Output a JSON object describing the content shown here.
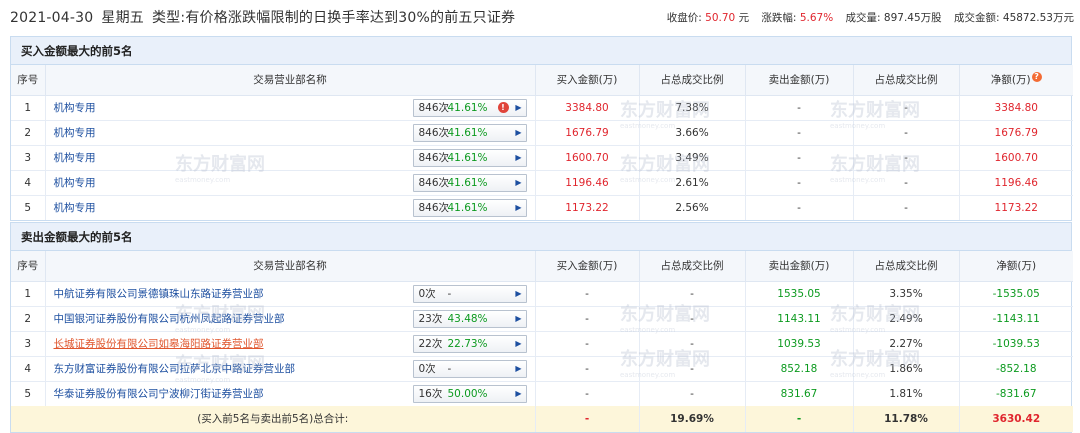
{
  "header": {
    "date": "2021-04-30",
    "weekday": "星期五",
    "type_label": "类型:",
    "type_value": "有价格涨跌幅限制的日换手率达到30%的前五只证券",
    "close_label": "收盘价:",
    "close_value": "50.70",
    "close_unit": "元",
    "change_label": "涨跌幅:",
    "change_value": "5.67%",
    "volume_label": "成交量:",
    "volume_value": "897.45万股",
    "amount_label": "成交金额:",
    "amount_value": "45872.53万元"
  },
  "watermark": {
    "text": "东方财富网",
    "subtext": "eastmoney.com"
  },
  "colors": {
    "red": "#e0262e",
    "green": "#0c9a1f",
    "link": "#1d4fa0",
    "header_bg": "#e9f0fa",
    "total_bg": "#fdf6da"
  },
  "buy": {
    "title": "买入金额最大的前5名",
    "columns": [
      "序号",
      "交易营业部名称",
      "买入金额(万)",
      "占总成交比例",
      "卖出金额(万)",
      "占总成交比例",
      "净额(万)"
    ],
    "rows": [
      {
        "idx": "1",
        "name": "机构专用",
        "count": "846次",
        "pct": "41.61%",
        "buy": "3384.80",
        "buy_ratio": "7.38%",
        "sell": "-",
        "sell_ratio": "-",
        "net": "3384.80",
        "has_tip": true
      },
      {
        "idx": "2",
        "name": "机构专用",
        "count": "846次",
        "pct": "41.61%",
        "buy": "1676.79",
        "buy_ratio": "3.66%",
        "sell": "-",
        "sell_ratio": "-",
        "net": "1676.79"
      },
      {
        "idx": "3",
        "name": "机构专用",
        "count": "846次",
        "pct": "41.61%",
        "buy": "1600.70",
        "buy_ratio": "3.49%",
        "sell": "-",
        "sell_ratio": "-",
        "net": "1600.70"
      },
      {
        "idx": "4",
        "name": "机构专用",
        "count": "846次",
        "pct": "41.61%",
        "buy": "1196.46",
        "buy_ratio": "2.61%",
        "sell": "-",
        "sell_ratio": "-",
        "net": "1196.46"
      },
      {
        "idx": "5",
        "name": "机构专用",
        "count": "846次",
        "pct": "41.61%",
        "buy": "1173.22",
        "buy_ratio": "2.56%",
        "sell": "-",
        "sell_ratio": "-",
        "net": "1173.22"
      }
    ]
  },
  "sell": {
    "title": "卖出金额最大的前5名",
    "columns": [
      "序号",
      "交易营业部名称",
      "买入金额(万)",
      "占总成交比例",
      "卖出金额(万)",
      "占总成交比例",
      "净额(万)"
    ],
    "rows": [
      {
        "idx": "1",
        "name": "中航证券有限公司景德镇珠山东路证券营业部",
        "count": "0次",
        "pct": "-",
        "buy": "-",
        "buy_ratio": "-",
        "sell": "1535.05",
        "sell_ratio": "3.35%",
        "net": "-1535.05"
      },
      {
        "idx": "2",
        "name": "中国银河证券股份有限公司杭州凤起路证券营业部",
        "count": "23次",
        "pct": "43.48%",
        "buy": "-",
        "buy_ratio": "-",
        "sell": "1143.11",
        "sell_ratio": "2.49%",
        "net": "-1143.11"
      },
      {
        "idx": "3",
        "name": "长城证券股份有限公司如皋海阳路证券营业部",
        "count": "22次",
        "pct": "22.73%",
        "buy": "-",
        "buy_ratio": "-",
        "sell": "1039.53",
        "sell_ratio": "2.27%",
        "net": "-1039.53",
        "highlight": true
      },
      {
        "idx": "4",
        "name": "东方财富证券股份有限公司拉萨北京中路证券营业部",
        "count": "0次",
        "pct": "-",
        "buy": "-",
        "buy_ratio": "-",
        "sell": "852.18",
        "sell_ratio": "1.86%",
        "net": "-852.18"
      },
      {
        "idx": "5",
        "name": "华泰证券股份有限公司宁波柳汀街证券营业部",
        "count": "16次",
        "pct": "50.00%",
        "buy": "-",
        "buy_ratio": "-",
        "sell": "831.67",
        "sell_ratio": "1.81%",
        "net": "-831.67"
      }
    ],
    "total": {
      "label": "(买入前5名与卖出前5名)总合计:",
      "buy": "-",
      "buy_ratio": "19.69%",
      "sell": "-",
      "sell_ratio": "11.78%",
      "net": "3630.42"
    }
  }
}
